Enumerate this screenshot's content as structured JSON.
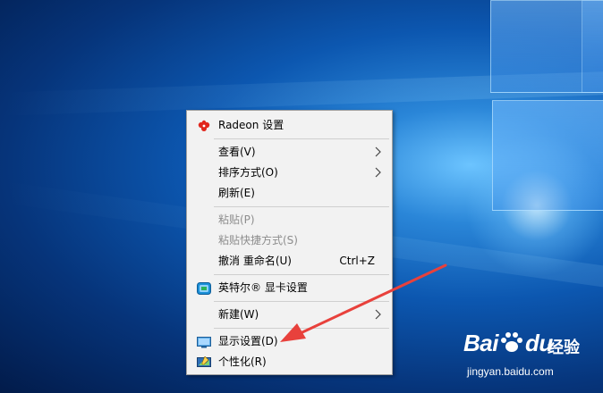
{
  "menu": {
    "items": [
      {
        "label": "Radeon 设置",
        "icon": "radeon-icon"
      },
      {
        "label": "查看(V)",
        "submenu": true
      },
      {
        "label": "排序方式(O)",
        "submenu": true
      },
      {
        "label": "刷新(E)"
      },
      {
        "label": "粘贴(P)",
        "disabled": true
      },
      {
        "label": "粘贴快捷方式(S)",
        "disabled": true
      },
      {
        "label": "撤消 重命名(U)",
        "shortcut": "Ctrl+Z"
      },
      {
        "label": "英特尔® 显卡设置",
        "icon": "intel-graphics-icon"
      },
      {
        "label": "新建(W)",
        "submenu": true
      },
      {
        "label": "显示设置(D)",
        "icon": "display-settings-icon"
      },
      {
        "label": "个性化(R)",
        "icon": "personalize-icon"
      }
    ]
  },
  "watermark": {
    "brand": "Bai",
    "brand_suffix": "du",
    "cn": "经验",
    "url": "jingyan.baidu.com"
  },
  "colors": {
    "menu_bg": "#f2f2f2",
    "disabled_text": "#8d8d8d",
    "annotation_arrow": "#e8413c",
    "radeon_red": "#e1261c",
    "intel_blue": "#1a8fd6"
  }
}
